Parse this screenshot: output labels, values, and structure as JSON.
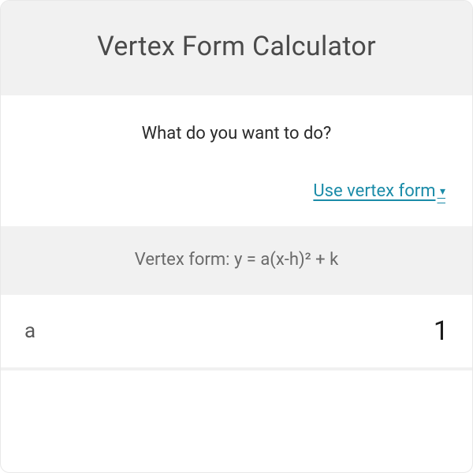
{
  "header": {
    "title": "Vertex Form Calculator"
  },
  "question": {
    "label": "What do you want to do?",
    "selected": "Use vertex form"
  },
  "formula": {
    "text": "Vertex form: y = a(x-h)² + k"
  },
  "inputs": {
    "a": {
      "label": "a",
      "value": "1"
    }
  }
}
